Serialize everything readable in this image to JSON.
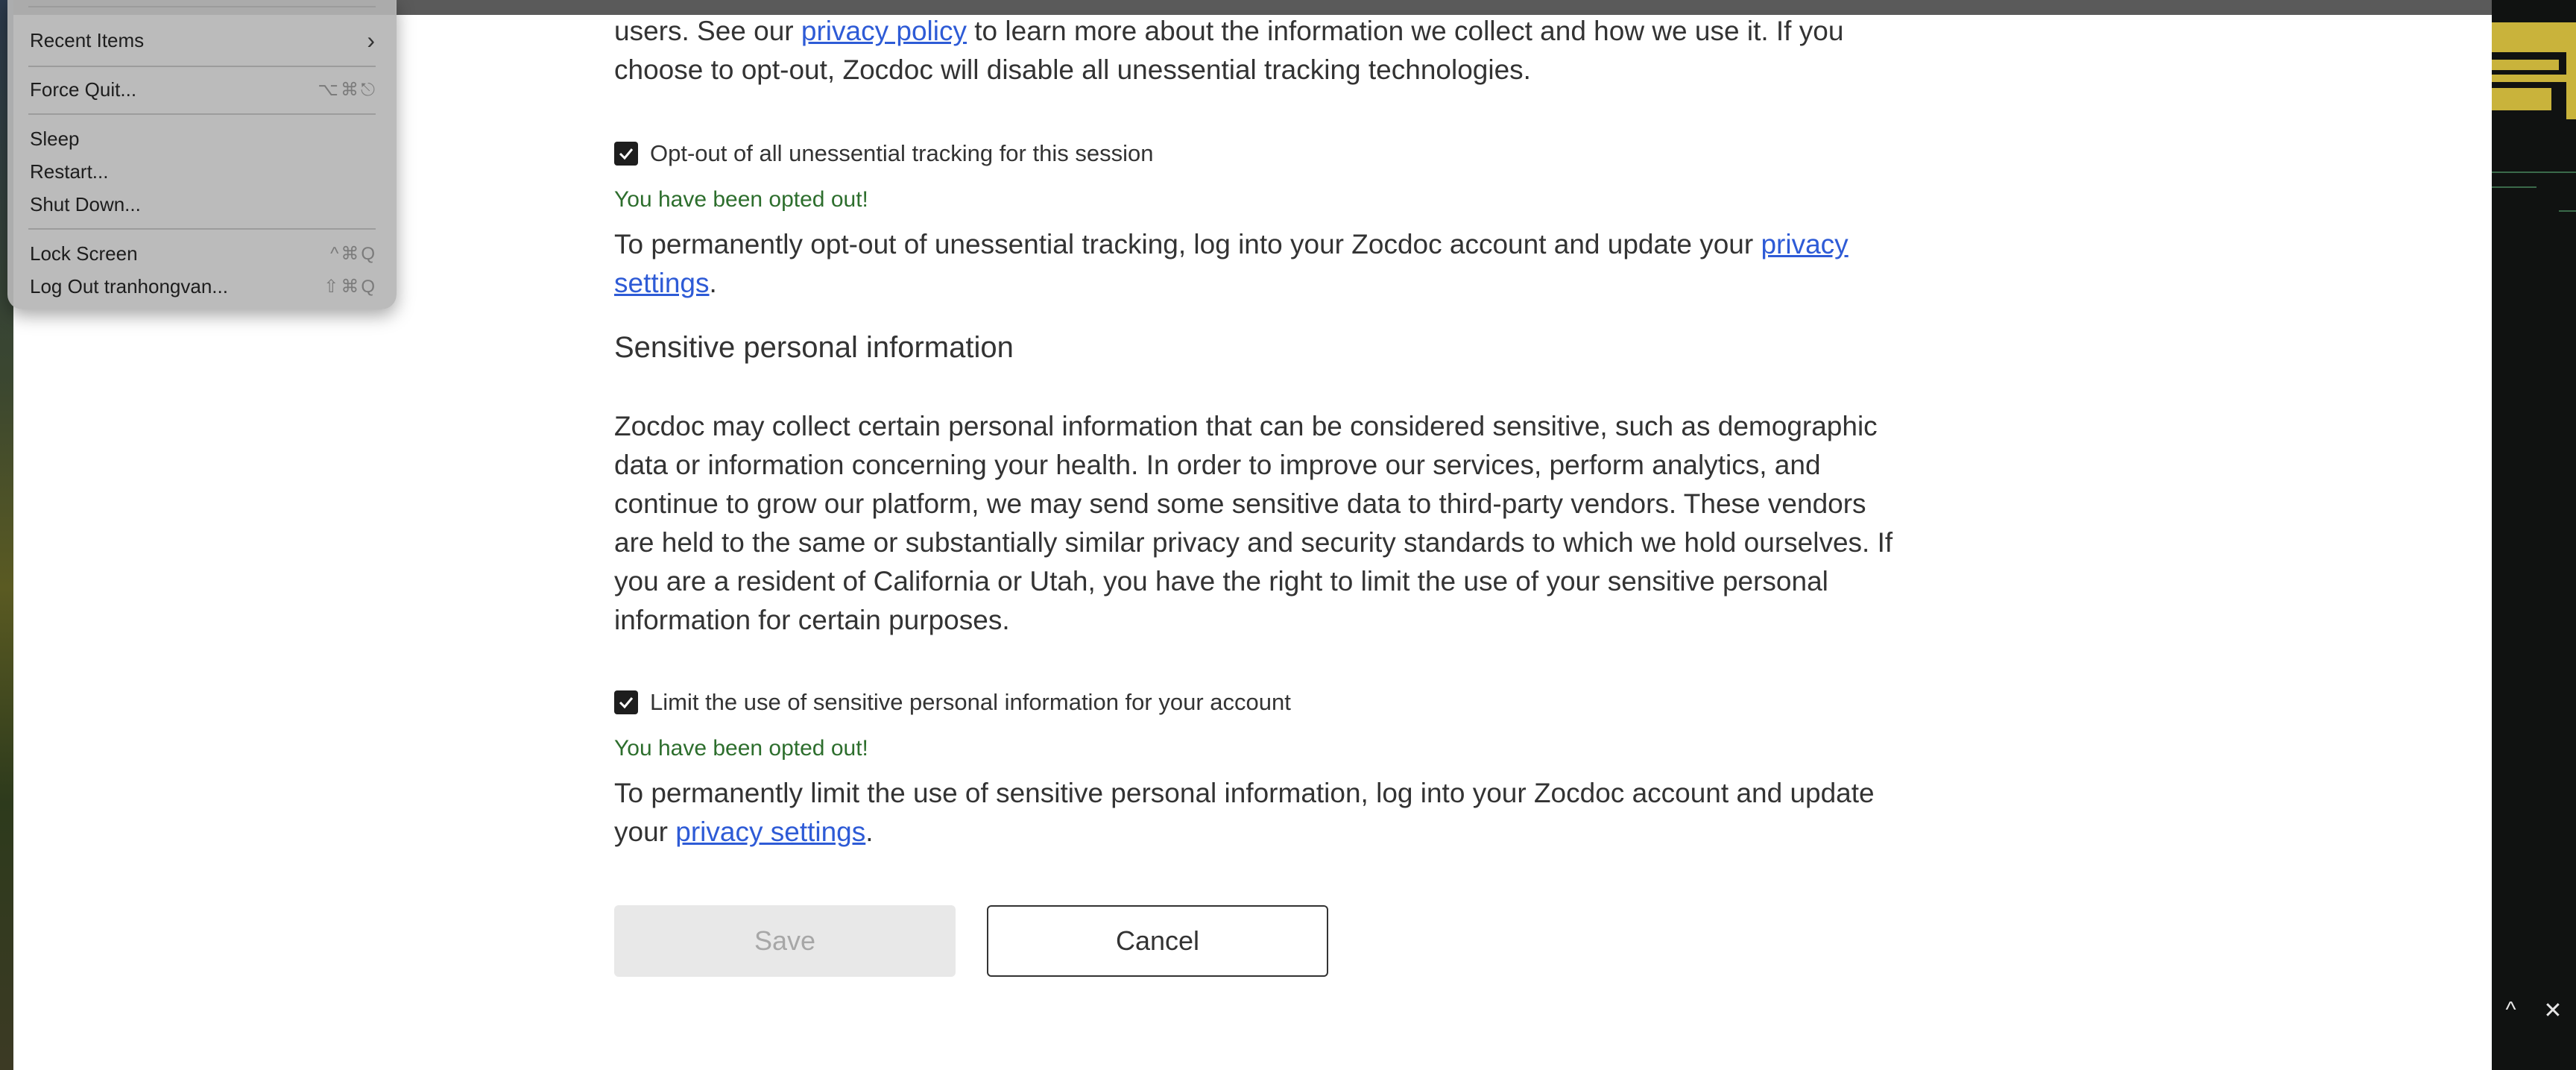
{
  "apple_menu": {
    "items": [
      {
        "label": "Recent Items",
        "shortcut": "›"
      },
      {
        "label": "Force Quit...",
        "shortcut": "⌥⌘⎋"
      },
      {
        "label": "Sleep",
        "shortcut": ""
      },
      {
        "label": "Restart...",
        "shortcut": ""
      },
      {
        "label": "Shut Down...",
        "shortcut": ""
      },
      {
        "label": "Lock Screen",
        "shortcut": "^⌘Q"
      },
      {
        "label": "Log Out tranhongvan...",
        "shortcut": "⇧⌘Q"
      }
    ]
  },
  "intro": {
    "line1_before": "users. See our ",
    "privacy_policy_link": "privacy policy",
    "line1_after": " to learn more about the information we collect and how we use it. If you",
    "line2": "choose to opt-out, Zocdoc will disable all unessential tracking technologies."
  },
  "tracking": {
    "checkbox_label": "Opt-out of all unessential tracking for this session",
    "checked": true,
    "success": "You have been opted out!",
    "permanent_before": "To permanently opt-out of unessential tracking, log into your Zocdoc account and update your ",
    "privacy_settings_link": "privacy settings",
    "permanent_after": "."
  },
  "sensitive": {
    "heading": "Sensitive personal information",
    "body": "Zocdoc may collect certain personal information that can be considered sensitive, such as demographic data or information concerning your health. In order to improve our services, perform analytics, and continue to grow our platform, we may send some sensitive data to third-party vendors. These vendors are held to the same or substantially similar privacy and security standards to which we hold ourselves. If you are a resident of California or Utah, you have the right to limit the use of your sensitive personal information for certain purposes.",
    "checkbox_label": "Limit the use of sensitive personal information for your account",
    "checked": true,
    "success": "You have been opted out!",
    "permanent_before": "To permanently limit the use of sensitive personal information, log into your Zocdoc account and update your ",
    "privacy_settings_link": "privacy settings",
    "permanent_after": "."
  },
  "buttons": {
    "save": "Save",
    "cancel": "Cancel"
  },
  "bottom_right": {
    "chevron": "^",
    "close": "✕"
  }
}
